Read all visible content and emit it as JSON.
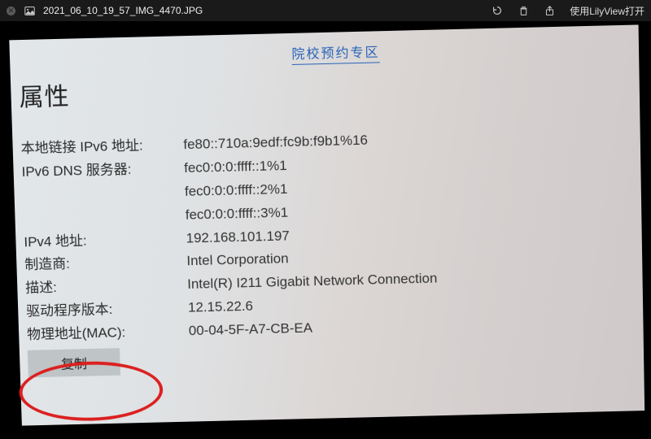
{
  "titlebar": {
    "filename": "2021_06_10_19_57_IMG_4470.JPG",
    "open_with": "使用LilyView打开"
  },
  "content": {
    "partial_link": "…院校预约专区",
    "section_title": "属性",
    "rows": [
      {
        "label": "本地链接 IPv6 地址:",
        "value": "fe80::710a:9edf:fc9b:f9b1%16"
      },
      {
        "label": "IPv6 DNS 服务器:",
        "value": "fec0:0:0:ffff::1%1\nfec0:0:0:ffff::2%1\nfec0:0:0:ffff::3%1"
      },
      {
        "label": "IPv4 地址:",
        "value": "192.168.101.197"
      },
      {
        "label": "制造商:",
        "value": "Intel Corporation"
      },
      {
        "label": "描述:",
        "value": "Intel(R) I211 Gigabit Network Connection"
      },
      {
        "label": "驱动程序版本:",
        "value": "12.15.22.6"
      },
      {
        "label": "物理地址(MAC):",
        "value": "00-04-5F-A7-CB-EA"
      }
    ],
    "copy_button": "复制"
  }
}
